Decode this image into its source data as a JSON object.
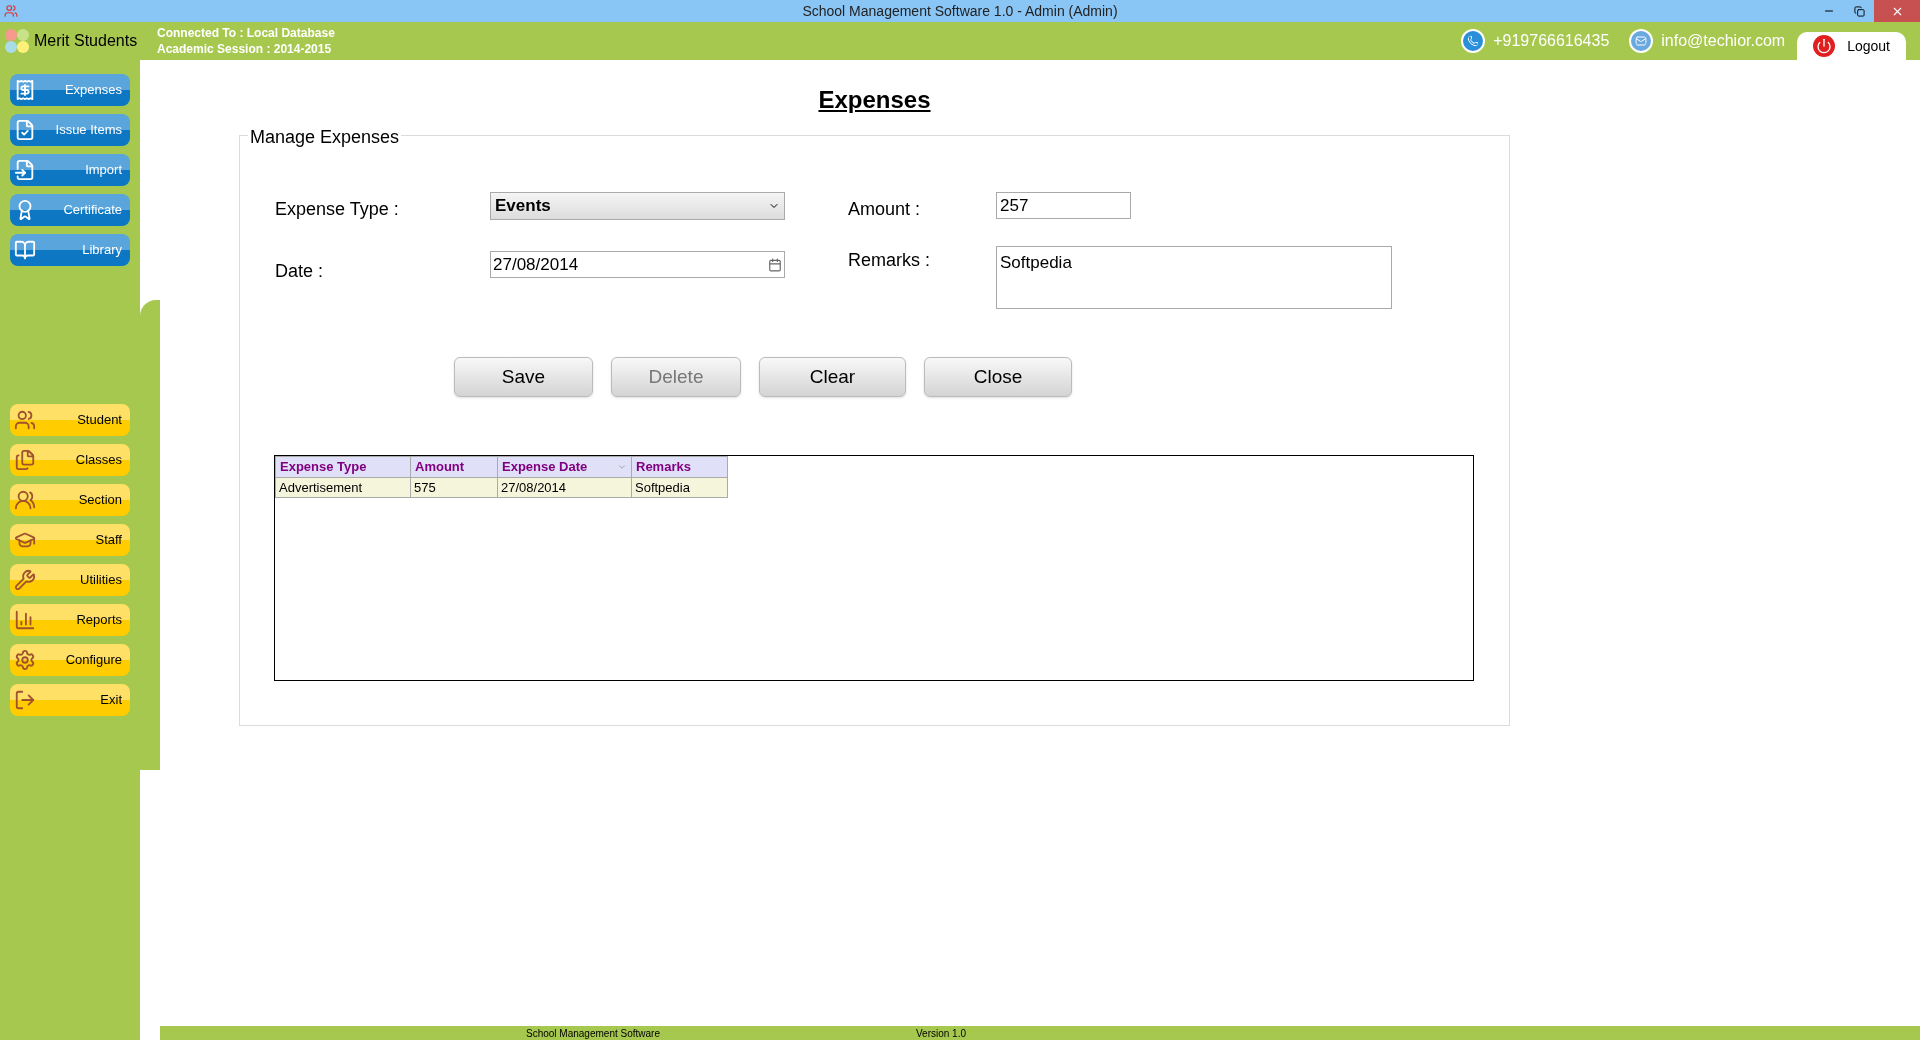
{
  "window": {
    "title": "School Management Software 1.0  -  Admin (Admin)"
  },
  "header": {
    "app_name": "Merit Students",
    "connection": "Connected To : Local Database",
    "session": "Academic Session : 2014-2015",
    "phone": "+919766616435",
    "email": "info@techior.com",
    "logout": "Logout"
  },
  "sidebar": {
    "top_items": [
      {
        "label": "Expenses"
      },
      {
        "label": "Issue Items"
      },
      {
        "label": "Import"
      },
      {
        "label": "Certificate"
      },
      {
        "label": "Library"
      }
    ],
    "bottom_items": [
      {
        "label": "Student"
      },
      {
        "label": "Classes"
      },
      {
        "label": "Section"
      },
      {
        "label": "Staff"
      },
      {
        "label": "Utilities"
      },
      {
        "label": "Reports"
      },
      {
        "label": "Configure"
      },
      {
        "label": "Exit"
      }
    ]
  },
  "page_title": "Expenses",
  "form": {
    "group_title": "Manage Expenses",
    "expense_type_label": "Expense Type :",
    "expense_type_value": "Events",
    "amount_label": "Amount :",
    "amount_value": "257",
    "date_label": "Date :",
    "date_value": "27/08/2014",
    "remarks_label": "Remarks :",
    "remarks_value": "Softpedia"
  },
  "buttons": [
    {
      "label": "Save",
      "disabled": false
    },
    {
      "label": "Delete",
      "disabled": true
    },
    {
      "label": "Clear",
      "disabled": false
    },
    {
      "label": "Close",
      "disabled": false
    }
  ],
  "table": {
    "columns": [
      {
        "label": "Expense Type",
        "sorted": false
      },
      {
        "label": "Amount",
        "sorted": false
      },
      {
        "label": "Expense Date",
        "sorted": true
      },
      {
        "label": "Remarks",
        "sorted": false
      }
    ],
    "rows": [
      [
        "Advertisement",
        "575",
        "27/08/2014",
        "Softpedia"
      ]
    ]
  },
  "status_bar": {
    "product": "School Management Software",
    "version": "Version 1.0"
  }
}
